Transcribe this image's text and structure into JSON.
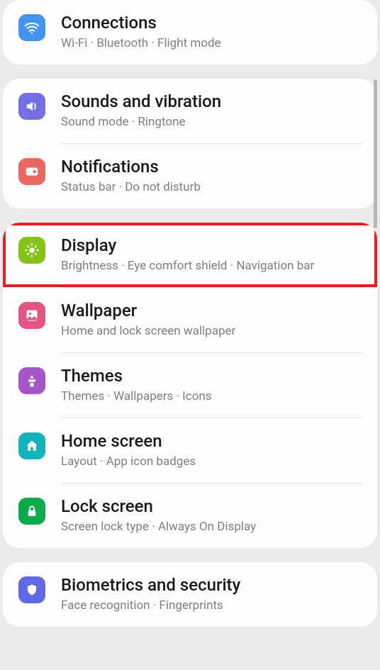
{
  "cards": [
    {
      "items": [
        {
          "id": "connections",
          "title": "Connections",
          "subtitle": "Wi-Fi  ·  Bluetooth  ·  Flight mode"
        }
      ]
    },
    {
      "items": [
        {
          "id": "sounds",
          "title": "Sounds and vibration",
          "subtitle": "Sound mode  ·  Ringtone"
        },
        {
          "id": "notifications",
          "title": "Notifications",
          "subtitle": "Status bar  ·  Do not disturb"
        }
      ]
    },
    {
      "items": [
        {
          "id": "display",
          "title": "Display",
          "subtitle": "Brightness  ·  Eye comfort shield  ·  Navigation bar"
        },
        {
          "id": "wallpaper",
          "title": "Wallpaper",
          "subtitle": "Home and lock screen wallpaper"
        },
        {
          "id": "themes",
          "title": "Themes",
          "subtitle": "Themes  ·  Wallpapers  ·  Icons"
        },
        {
          "id": "homescreen",
          "title": "Home screen",
          "subtitle": "Layout  ·  App icon badges"
        },
        {
          "id": "lockscreen",
          "title": "Lock screen",
          "subtitle": "Screen lock type  ·  Always On Display"
        }
      ]
    },
    {
      "items": [
        {
          "id": "biometrics",
          "title": "Biometrics and security",
          "subtitle": "Face recognition  ·  Fingerprints"
        }
      ]
    }
  ],
  "highlight_id": "display"
}
